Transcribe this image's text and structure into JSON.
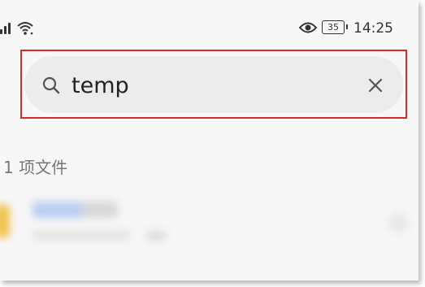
{
  "status_bar": {
    "battery": "35",
    "time": "14:25"
  },
  "search": {
    "query": "temp"
  },
  "results": {
    "count_label": "1 项文件"
  }
}
